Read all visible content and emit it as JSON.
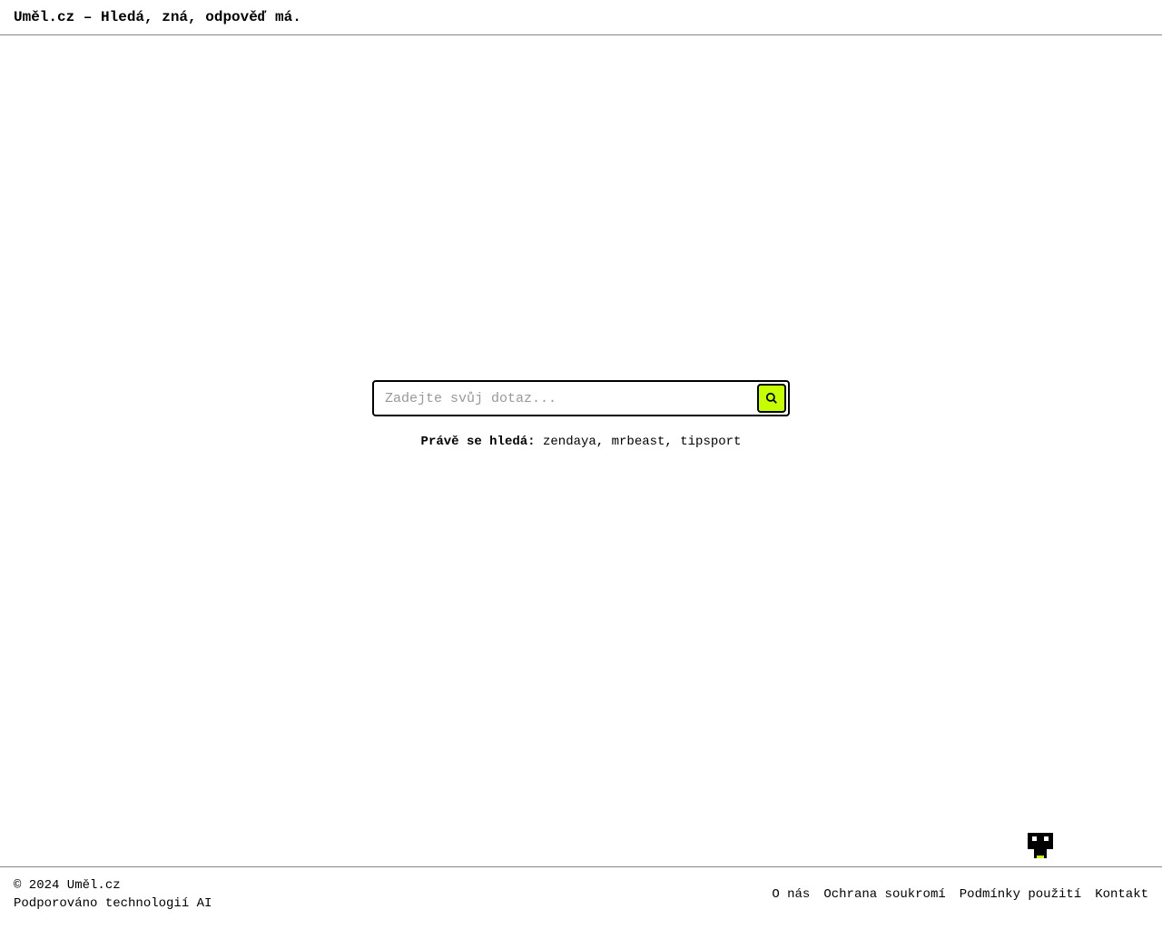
{
  "header": {
    "title": "Uměl.cz – Hledá, zná, odpověď má."
  },
  "search": {
    "placeholder": "Zadejte svůj dotaz...",
    "value": ""
  },
  "trending": {
    "label": "Právě se hledá:",
    "items": [
      "zendaya",
      "mrbeast",
      "tipsport"
    ],
    "separator": ", "
  },
  "footer": {
    "copyright": "© 2024 Uměl.cz",
    "tagline": "Podporováno technologií AI",
    "links": [
      {
        "label": "O nás"
      },
      {
        "label": "Ochrana soukromí"
      },
      {
        "label": "Podmínky použití"
      },
      {
        "label": "Kontakt"
      }
    ]
  }
}
